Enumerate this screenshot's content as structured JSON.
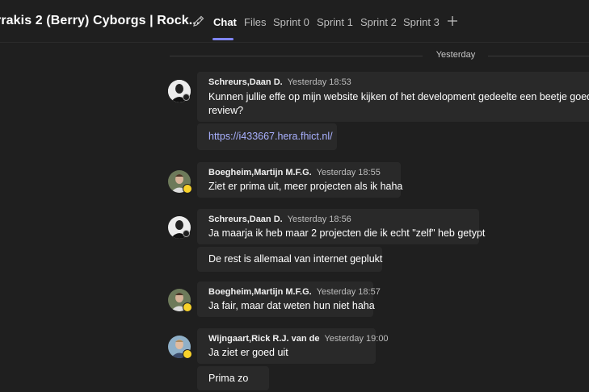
{
  "header": {
    "title": "rrakis 2 (Berry) Cyborgs | Rock...",
    "tabs": [
      {
        "label": "Chat",
        "active": true
      },
      {
        "label": "Files"
      },
      {
        "label": "Sprint 0"
      },
      {
        "label": "Sprint 1"
      },
      {
        "label": "Sprint 2"
      },
      {
        "label": "Sprint 3"
      }
    ]
  },
  "divider": {
    "label": "Yesterday"
  },
  "messages": [
    {
      "author": "Schreurs,Daan D.",
      "time": "Yesterday 18:53",
      "lines": [
        "Kunnen jullie effe op mijn website kijken of het development gedeelte een beetje goed is v",
        "review?"
      ]
    },
    {
      "text": "https://i433667.hera.fhict.nl/"
    },
    {
      "author": "Boegheim,Martijn M.F.G.",
      "time": "Yesterday 18:55",
      "lines": [
        "Ziet er prima uit, meer projecten als ik haha"
      ]
    },
    {
      "author": "Schreurs,Daan D.",
      "time": "Yesterday 18:56",
      "lines": [
        "Ja maarja ik heb maar 2 projecten die ik echt \"zelf\" heb getypt"
      ]
    },
    {
      "text": "De rest is allemaal van internet geplukt"
    },
    {
      "author": "Boegheim,Martijn M.F.G.",
      "time": "Yesterday 18:57",
      "lines": [
        "Ja fair, maar dat weten hun niet haha"
      ]
    },
    {
      "author": "Wijngaart,Rick R.J. van de",
      "time": "Yesterday 19:00",
      "lines": [
        "Ja ziet er goed uit"
      ]
    },
    {
      "text": "Prima zo"
    }
  ],
  "colors": {
    "accent": "#7f85f5",
    "link": "#a9b1ff",
    "away": "#f8d22a"
  }
}
